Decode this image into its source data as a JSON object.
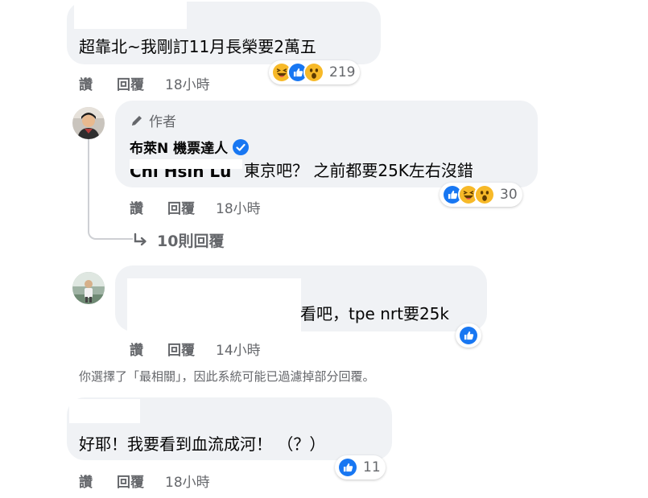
{
  "actions": {
    "like": "讚",
    "reply": "回覆"
  },
  "comments": [
    {
      "text": "超靠北~我剛訂11月長榮要2萬五",
      "time": "18小時",
      "reaction_count": "219",
      "reactions": [
        "haha",
        "like",
        "wow"
      ]
    },
    {
      "author_badge": "作者",
      "author_name": "布萊N 機票達人",
      "text_visible": "Chi Hsin Lu",
      "text": "東京吧？ 之前都要25K左右沒錯",
      "time": "18小時",
      "reaction_count": "30",
      "reactions": [
        "like",
        "haha",
        "wow"
      ],
      "replies_link": "10則回覆"
    },
    {
      "text": "看吧，tpe nrt要25k",
      "time": "14小時",
      "reactions": [
        "like"
      ]
    },
    {
      "text": "好耶！我要看到血流成河！ （？）",
      "time": "18小時",
      "reaction_count": "11",
      "reactions": [
        "like"
      ]
    }
  ],
  "filter_notice": "你選擇了「最相關」，因此系統可能已過濾掉部分回覆。",
  "colors": {
    "like": "#1877f2",
    "haha": "#f7b928",
    "bubble": "#f0f2f5",
    "meta": "#65676b"
  }
}
